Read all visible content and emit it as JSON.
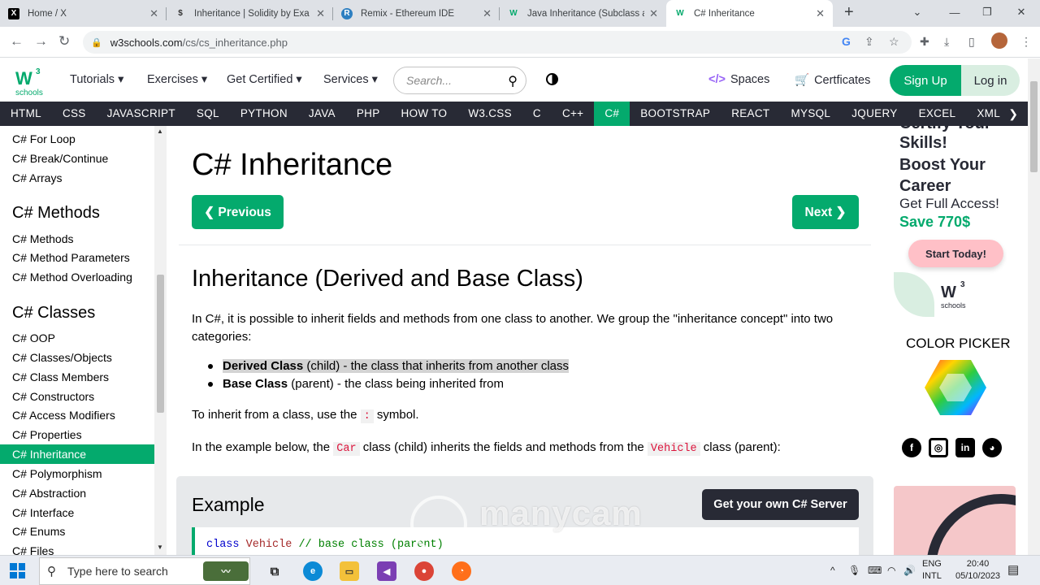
{
  "browser": {
    "tabs": [
      {
        "title": "Home / X",
        "favicon": "X"
      },
      {
        "title": "Inheritance | Solidity by Exa",
        "favicon": "$"
      },
      {
        "title": "Remix - Ethereum IDE",
        "favicon": "R"
      },
      {
        "title": "Java Inheritance (Subclass a",
        "favicon": "W"
      },
      {
        "title": "C# Inheritance",
        "favicon": "W"
      }
    ],
    "new_tab": "+",
    "url_host": "w3schools.com",
    "url_path": "/cs/cs_inheritance.php"
  },
  "header": {
    "menu": [
      "Tutorials ▾",
      "Exercises ▾",
      "Get Certified ▾",
      "Services ▾"
    ],
    "search_placeholder": "Search...",
    "spaces": "Spaces",
    "certificates": "Certficates",
    "signup": "Sign Up",
    "login": "Log in",
    "logo_sup": "3",
    "logo_text": "schools"
  },
  "topnav": [
    "HTML",
    "CSS",
    "JAVASCRIPT",
    "SQL",
    "PYTHON",
    "JAVA",
    "PHP",
    "HOW TO",
    "W3.CSS",
    "C",
    "C++",
    "C#",
    "BOOTSTRAP",
    "REACT",
    "MYSQL",
    "JQUERY",
    "EXCEL",
    "XML"
  ],
  "sidebar": {
    "top_items": [
      "C# For Loop",
      "C# Break/Continue",
      "C# Arrays"
    ],
    "methods_head": "C# Methods",
    "methods_items": [
      "C# Methods",
      "C# Method Parameters",
      "C# Method Overloading"
    ],
    "classes_head": "C# Classes",
    "classes_items": [
      "C# OOP",
      "C# Classes/Objects",
      "C# Class Members",
      "C# Constructors",
      "C# Access Modifiers",
      "C# Properties",
      "C# Inheritance",
      "C# Polymorphism",
      "C# Abstraction",
      "C# Interface",
      "C# Enums",
      "C# Files"
    ]
  },
  "main": {
    "title": "C# Inheritance",
    "prev": "❮ Previous",
    "next": "Next ❯",
    "h2": "Inheritance (Derived and Base Class)",
    "intro": "In C#, it is possible to inherit fields and methods from one class to another. We group the \"inheritance concept\" into two categories:",
    "derived_bold": "Derived Class",
    "derived_rest": " (child) - the class that inherits from another class",
    "base_bold": "Base Class",
    "base_rest": " (parent) - the class being inherited from",
    "symbol_pre": "To inherit from a class, use the ",
    "symbol_code": ":",
    "symbol_post": " symbol.",
    "example_pre": "In the example below, the ",
    "car": "Car",
    "example_mid": " class (child) inherits the fields and methods from the ",
    "vehicle": "Vehicle",
    "example_post": " class (parent):",
    "example_title": "Example",
    "example_button": "Get your own C# Server",
    "code_kw": "class",
    "code_cls": "Vehicle",
    "code_cm": "// base class (parent)"
  },
  "ad": {
    "line0": "Certify Your",
    "line1": "Skills!",
    "line2": "Boost Your",
    "line3": "Career",
    "full": "Get Full Access!",
    "save": "Save 770$",
    "start": "Start Today!",
    "color_picker": "COLOR PICKER"
  },
  "watermark": "manycam",
  "taskbar": {
    "search": "Type here to search",
    "lang1": "ENG",
    "lang2": "INTL",
    "time": "20:40",
    "date": "05/10/2023"
  },
  "colors": {
    "accent": "#04aa6d",
    "nav": "#282a35"
  }
}
